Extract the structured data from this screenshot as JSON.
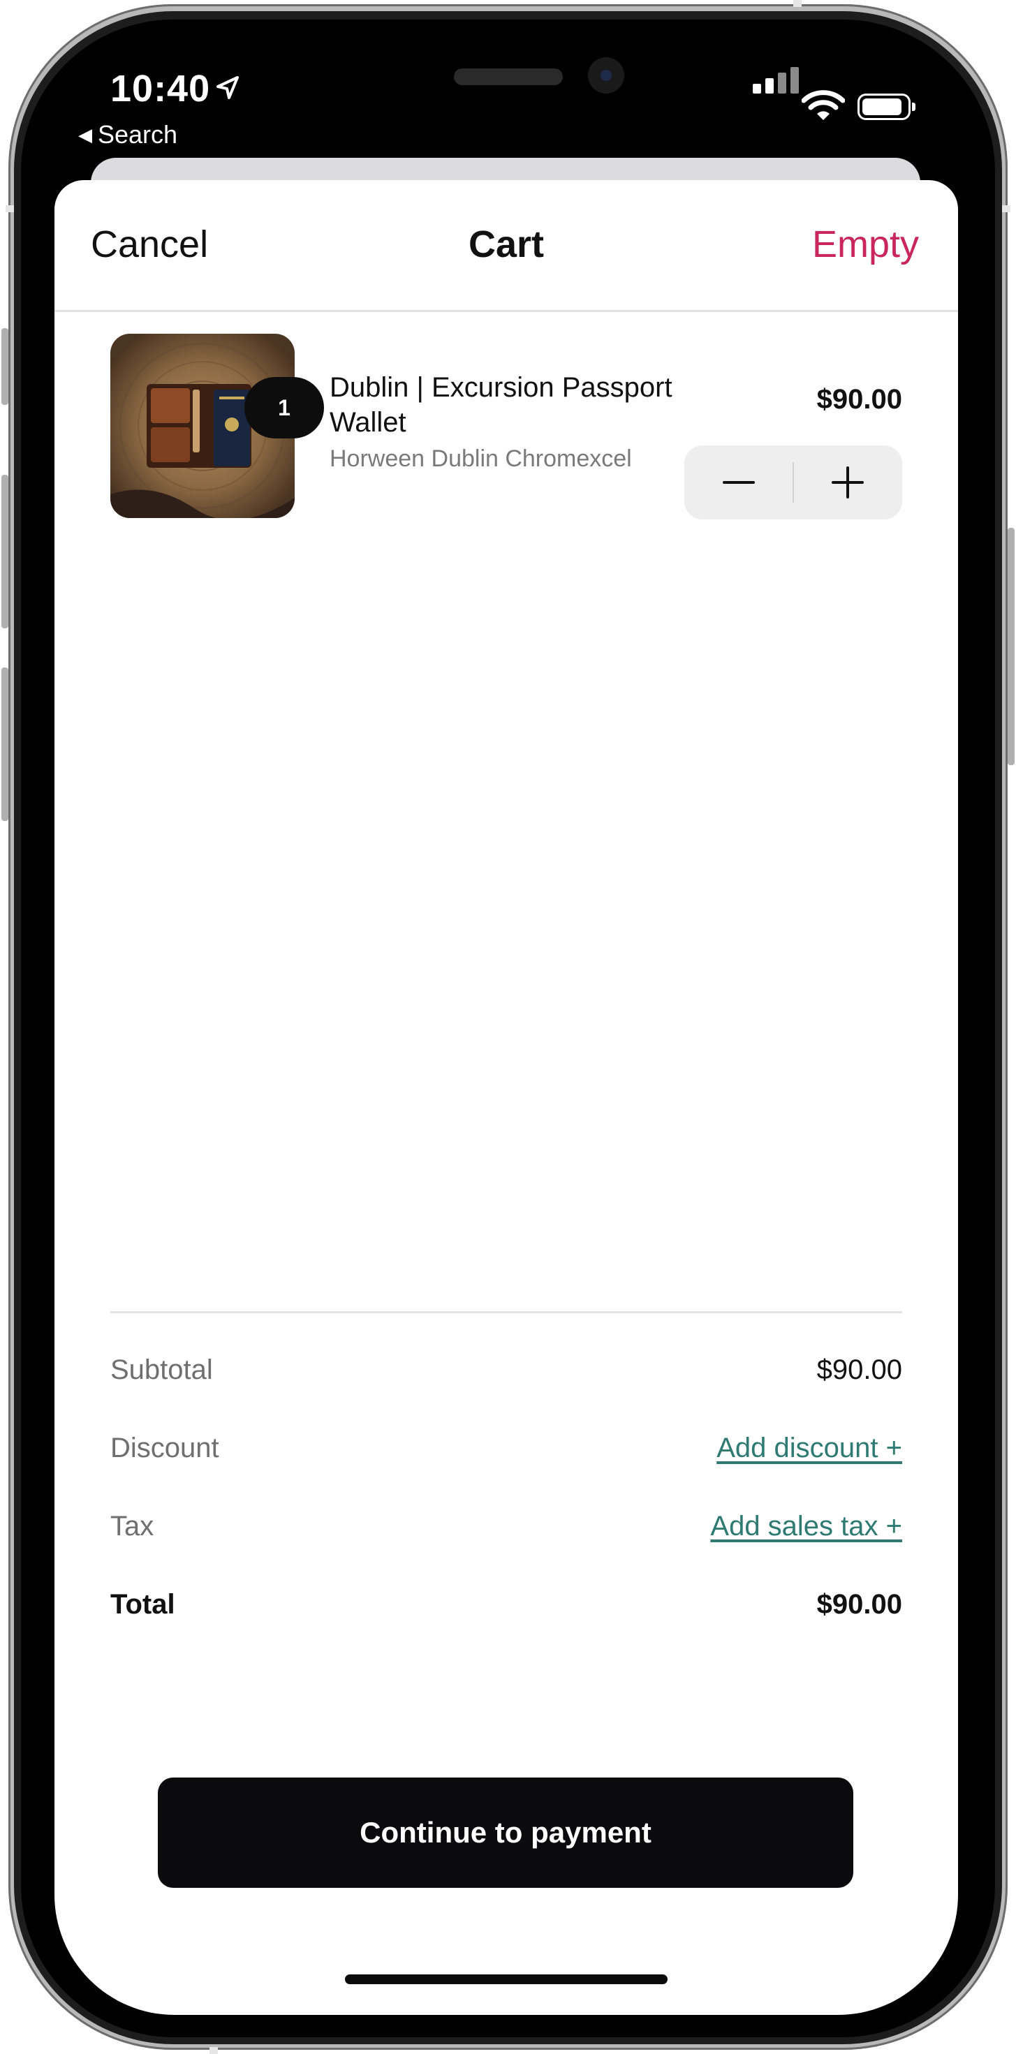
{
  "status_bar": {
    "time": "10:40",
    "back_label": "Search"
  },
  "nav": {
    "cancel_label": "Cancel",
    "title": "Cart",
    "empty_label": "Empty"
  },
  "cart": {
    "items": [
      {
        "quantity": "1",
        "name": "Dublin | Excursion Passport Wallet",
        "variant": "Horween Dublin Chromexcel",
        "price": "$90.00"
      }
    ]
  },
  "summary": {
    "subtotal_label": "Subtotal",
    "subtotal_value": "$90.00",
    "discount_label": "Discount",
    "discount_action": "Add discount +",
    "tax_label": "Tax",
    "tax_action": "Add sales tax +",
    "total_label": "Total",
    "total_value": "$90.00"
  },
  "actions": {
    "continue_label": "Continue to payment"
  },
  "colors": {
    "accent_empty": "#c8265c",
    "link_teal": "#2f7a72",
    "primary_button": "#0b0b0d"
  },
  "icons": [
    "location-arrow-icon",
    "back-triangle-icon",
    "signal-icon",
    "wifi-icon",
    "battery-icon",
    "minus-icon",
    "plus-icon"
  ]
}
